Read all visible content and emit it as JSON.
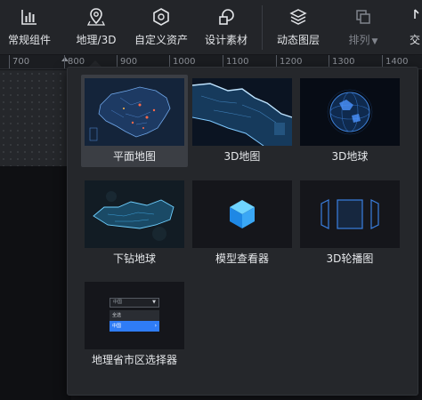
{
  "toolbar": {
    "items": [
      {
        "label": "常规组件",
        "icon": "bar-chart-icon"
      },
      {
        "label": "地理/3D",
        "icon": "map-pin-icon"
      },
      {
        "label": "自定义资产",
        "icon": "hexagon-icon"
      },
      {
        "label": "设计素材",
        "icon": "shapes-icon"
      },
      {
        "label": "动态图层",
        "icon": "layers-icon"
      },
      {
        "label": "排列",
        "icon": "arrange-icon",
        "disabled": true
      },
      {
        "label": "交",
        "icon": "interaction-icon"
      }
    ]
  },
  "ruler": {
    "ticks": [
      "700",
      "800",
      "900",
      "1000",
      "1100",
      "1200",
      "1300",
      "1400"
    ]
  },
  "geo_panel": {
    "items": [
      {
        "label": "平面地图",
        "selected": true
      },
      {
        "label": "3D地图",
        "selected": false
      },
      {
        "label": "3D地球",
        "selected": false
      },
      {
        "label": "下钻地球",
        "selected": false
      },
      {
        "label": "模型查看器",
        "selected": false
      },
      {
        "label": "3D轮播图",
        "selected": false
      },
      {
        "label": "地理省市区选择器",
        "selected": false
      }
    ],
    "selector_preview": {
      "select_value": "中国",
      "options": [
        "全选",
        "中国"
      ]
    }
  },
  "colors": {
    "toolbar_bg": "#232529",
    "panel_bg": "#25272b",
    "selected_card_bg": "#3b3e44",
    "accent_blue": "#2f7cf6"
  }
}
